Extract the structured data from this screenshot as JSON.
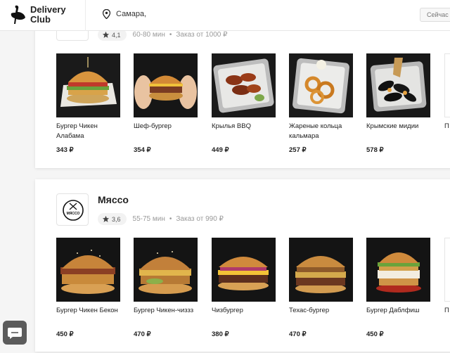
{
  "header": {
    "brand_line1": "Delivery",
    "brand_line2": "Club",
    "address": "Самара,",
    "now_button": "Сейчас"
  },
  "restaurants": [
    {
      "name": "",
      "rating": "4,1",
      "time": "60-80 мин",
      "min_order": "Заказ от 1000 ₽",
      "dishes": [
        {
          "name": "Бургер Чикен Алабама",
          "price": "343 ₽"
        },
        {
          "name": "Шеф-бургер",
          "price": "354 ₽"
        },
        {
          "name": "Крылья BBQ",
          "price": "449 ₽"
        },
        {
          "name": "Жареные кольца кальмара",
          "price": "257 ₽"
        },
        {
          "name": "Крымские мидии",
          "price": "578 ₽"
        },
        {
          "name": "П",
          "price": ""
        }
      ]
    },
    {
      "name": "Мяссо",
      "logo_text": "МЯССО",
      "rating": "3,6",
      "time": "55-75 мин",
      "min_order": "Заказ от 990 ₽",
      "dishes": [
        {
          "name": "Бургер Чикен Бекон",
          "price": "450 ₽"
        },
        {
          "name": "Бургер Чикен-чиззз",
          "price": "470 ₽"
        },
        {
          "name": "Чизбургер",
          "price": "380 ₽"
        },
        {
          "name": "Техас-бургер",
          "price": "470 ₽"
        },
        {
          "name": "Бургер Даблфиш",
          "price": "450 ₽"
        },
        {
          "name": "П",
          "price": ""
        }
      ]
    }
  ],
  "colors": {
    "accent": "#222222",
    "muted": "#9a9a9a",
    "background": "#f5f5f5"
  }
}
